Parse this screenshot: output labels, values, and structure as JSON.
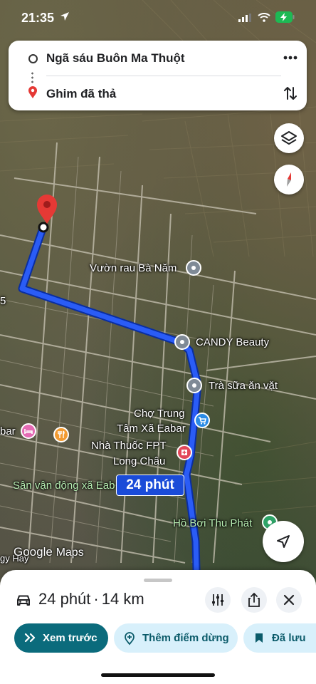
{
  "status_bar": {
    "time": "21:35"
  },
  "route_card": {
    "origin": "Ngã sáu Buôn Ma Thuột",
    "destination": "Ghim đã thả",
    "more_icon": "more-horizontal-icon",
    "swap_icon": "swap-vertical-icon"
  },
  "map": {
    "edge_label": "5",
    "edge_label_left": "bar",
    "edge_label_bottom": "gy Hay",
    "pois": [
      {
        "name": "Vườn rau Bà Năm",
        "type": "place"
      },
      {
        "name": "CANDY Beauty",
        "type": "place"
      },
      {
        "name": "Trà sữa ăn vặt",
        "type": "place"
      },
      {
        "name_line1": "Chợ Trung",
        "name_line2": "Tâm Xã Eabar",
        "type": "shopping"
      },
      {
        "name_line1": "Nhà Thuốc FPT",
        "name_line2": "Long Châu",
        "type": "pharmacy"
      },
      {
        "name": "Sân vận động xã Eab",
        "type": "park"
      },
      {
        "name": "Hồ Bơi Thu Phát",
        "type": "park"
      }
    ],
    "eta_label": "24 phút",
    "logo_google": "Google",
    "logo_maps": "Maps",
    "route_color": "#1a4bd8",
    "pin_color": "#e53935"
  },
  "bottom_sheet": {
    "duration": "24 phút",
    "separator": "·",
    "distance": "14 km",
    "buttons": {
      "preview": "Xem trước",
      "add_stop": "Thêm điểm dừng",
      "saved": "Đã lưu"
    },
    "accent_color": "#0b6b7c"
  }
}
